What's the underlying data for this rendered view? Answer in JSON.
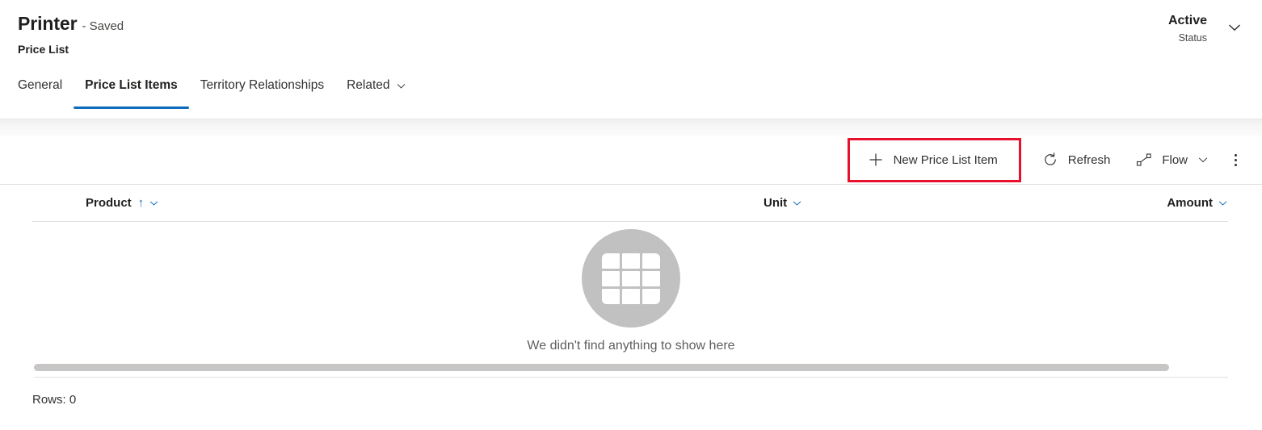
{
  "header": {
    "record_title": "Printer",
    "saved_state": "- Saved",
    "entity_name": "Price List",
    "status_value": "Active",
    "status_label": "Status",
    "status_chevron_icon": "chevron-down-icon"
  },
  "tabs": [
    {
      "label": "General",
      "selected": false,
      "has_chevron": false
    },
    {
      "label": "Price List Items",
      "selected": true,
      "has_chevron": false
    },
    {
      "label": "Territory Relationships",
      "selected": false,
      "has_chevron": false
    },
    {
      "label": "Related",
      "selected": false,
      "has_chevron": true,
      "chevron_icon": "chevron-down-icon"
    }
  ],
  "command_bar": {
    "new_item": {
      "label": "New Price List Item",
      "icon": "plus-icon",
      "highlighted": true,
      "highlight_color": "#e8112d"
    },
    "refresh": {
      "label": "Refresh",
      "icon": "refresh-icon"
    },
    "flow": {
      "label": "Flow",
      "icon": "flow-icon",
      "chevron_icon": "chevron-down-icon"
    },
    "overflow": {
      "icon": "more-vertical-icon"
    }
  },
  "grid": {
    "columns": [
      {
        "label": "Product",
        "sorted": true,
        "sort_icon": "sort-ascending-arrow-icon",
        "chevron_icon": "chevron-down-icon"
      },
      {
        "label": "Unit",
        "sorted": false,
        "chevron_icon": "chevron-down-icon"
      },
      {
        "label": "Amount",
        "sorted": false,
        "chevron_icon": "chevron-down-icon"
      }
    ],
    "rows": [],
    "empty_message": "We didn't find anything to show here",
    "empty_icon": "grid-table-icon",
    "rows_count_label": "Rows: 0"
  },
  "colors": {
    "accent": "#0f6cbd",
    "highlight": "#e8112d",
    "text_primary": "#201f1e",
    "text_secondary": "#605e5c",
    "divider": "#e1dfdd"
  }
}
